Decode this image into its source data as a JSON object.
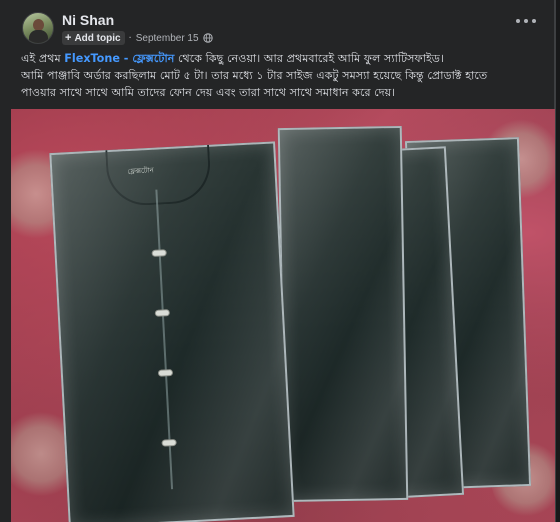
{
  "post": {
    "author": "Ni Shan",
    "add_topic_label": "Add topic",
    "separator": "·",
    "date": "September 15",
    "privacy_icon": "globe-icon",
    "more_icon": "more-horizontal-icon",
    "text": {
      "line1_pre": "এই প্রথম ",
      "brand_link": "FlexTone - ফ্লেক্সটোন",
      "line1_post": " থেকে কিছু নেওয়া। আর প্রথমবারেই আমি ফুল স্যাটিসফাইড।",
      "line2": "আমি পাঞ্জাবি অর্ডার করছিলাম মোট ৫ টা। তার মধ্যে ১ টার সাইজ একটু সমস্যা হয়েছে কিন্তু প্রোডাক্ট হাতে",
      "line3": "পাওয়ার সাথে সাথে আমি তাদের ফোন দেয় এবং তারা সাথে সাথে সমাধান করে দেয়।"
    },
    "photo": {
      "subject": "Packaged dark teal panjabis on a red floral bedsheet",
      "brand_mark": "ফ্লেক্সটোন"
    }
  },
  "colors": {
    "background": "#18191a",
    "card": "#242526",
    "link": "#4599ff",
    "text": "#e4e6eb",
    "muted": "#b0b3b8"
  }
}
